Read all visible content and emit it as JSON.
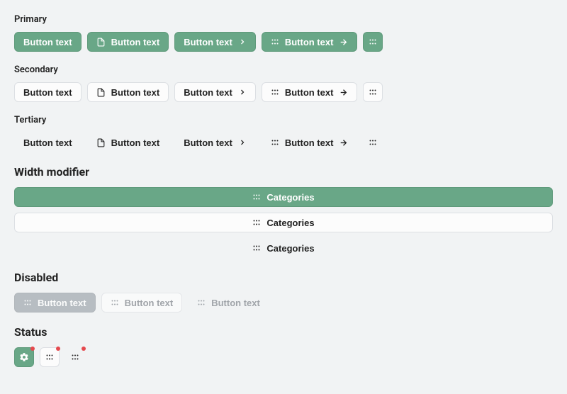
{
  "sections": {
    "primary": {
      "label": "Primary"
    },
    "secondary": {
      "label": "Secondary"
    },
    "tertiary": {
      "label": "Tertiary"
    },
    "width": {
      "heading": "Width modifier"
    },
    "disabled": {
      "heading": "Disabled"
    },
    "status": {
      "heading": "Status"
    }
  },
  "button": {
    "text": "Button text",
    "categories": "Categories"
  },
  "colors": {
    "primary": "#69a787",
    "status_dot": "#e5484d"
  },
  "icons": {
    "file": "file-icon",
    "chevron_right": "chevron-right-icon",
    "arrow_right": "arrow-right-icon",
    "grid": "grid-icon",
    "gear": "gear-icon"
  }
}
